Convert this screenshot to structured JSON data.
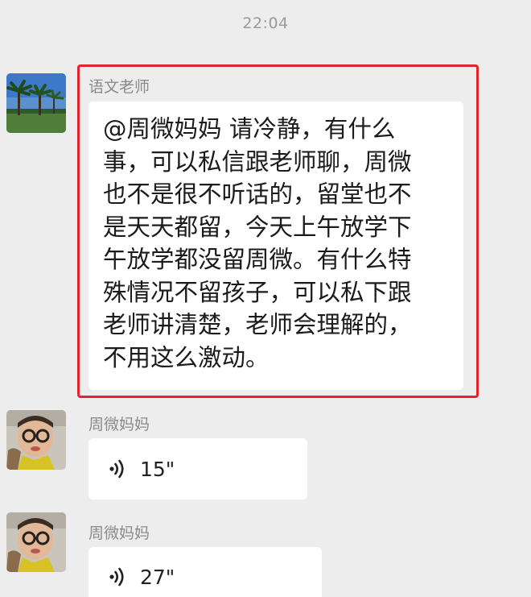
{
  "chat": {
    "timestamp": "22:04",
    "messages": [
      {
        "sender": "语文老师",
        "type": "text",
        "avatar_icon": "palm-tree-photo-avatar",
        "text": "@周微妈妈  请冷静，有什么\n事，可以私信跟老师聊，周微\n也不是很不听话的，留堂也不\n是天天都留，今天上午放学下\n午放学都没留周微。有什么特\n殊情况不留孩子，可以私下跟\n老师讲清楚，老师会理解的，\n不用这么激动。",
        "highlighted": true,
        "highlight_color": "#e0262b"
      },
      {
        "sender": "周微妈妈",
        "type": "voice",
        "avatar_icon": "child-with-glasses-avatar",
        "duration": "15\""
      },
      {
        "sender": "周微妈妈",
        "type": "voice",
        "avatar_icon": "child-with-glasses-avatar",
        "duration": "27\""
      }
    ]
  },
  "colors": {
    "background": "#ededed",
    "bubble": "#ffffff",
    "highlight": "#e0262b"
  }
}
